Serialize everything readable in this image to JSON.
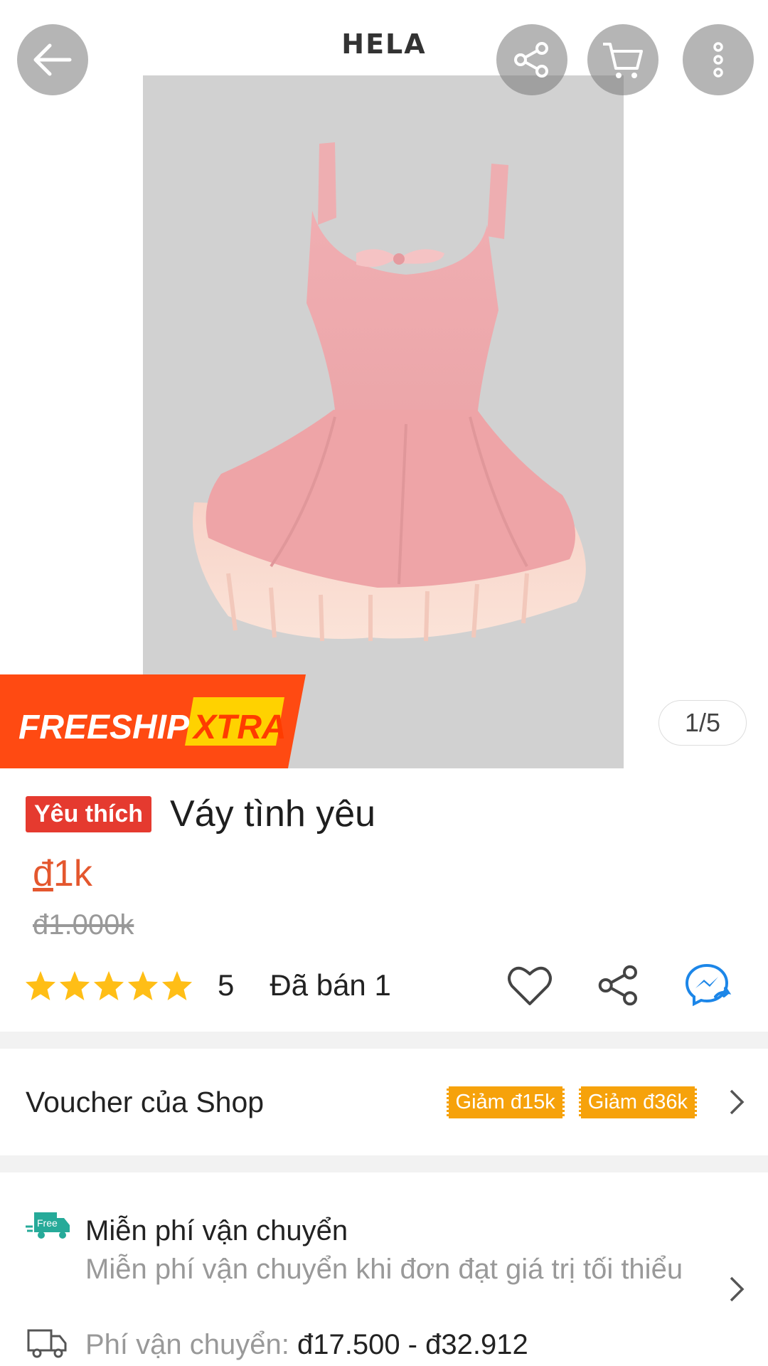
{
  "header": {
    "title": "HELA"
  },
  "gallery": {
    "counter": "1/5",
    "freeship_badge": {
      "left": "FREESHIP",
      "right": "XTRA"
    }
  },
  "product": {
    "badge": "Yêu thích",
    "name": "Váy tình yêu",
    "price_currency": "đ",
    "price_value": "1k",
    "old_price": "đ1.000k",
    "rating": "5",
    "stars": 5,
    "sold": "Đã bán 1"
  },
  "voucher": {
    "label": "Voucher của Shop",
    "tags": [
      "Giảm đ15k",
      "Giảm đ36k"
    ]
  },
  "shipping": {
    "free_icon_text": "Free",
    "title": "Miễn phí vận chuyển",
    "subtitle": "Miễn phí vận chuyển khi đơn đạt giá trị tối thiểu",
    "fee_label": "Phí vận chuyển: ",
    "fee_range": "đ17.500 - đ32.912"
  },
  "colors": {
    "accent": "#e4572e",
    "badge": "#e53a2f",
    "voucher": "#f6a20b",
    "freeship_bg": "#ff4a12",
    "freeship_xtra_bg": "#ffd200",
    "star": "#ffbe16",
    "messenger": "#1c86e8"
  }
}
